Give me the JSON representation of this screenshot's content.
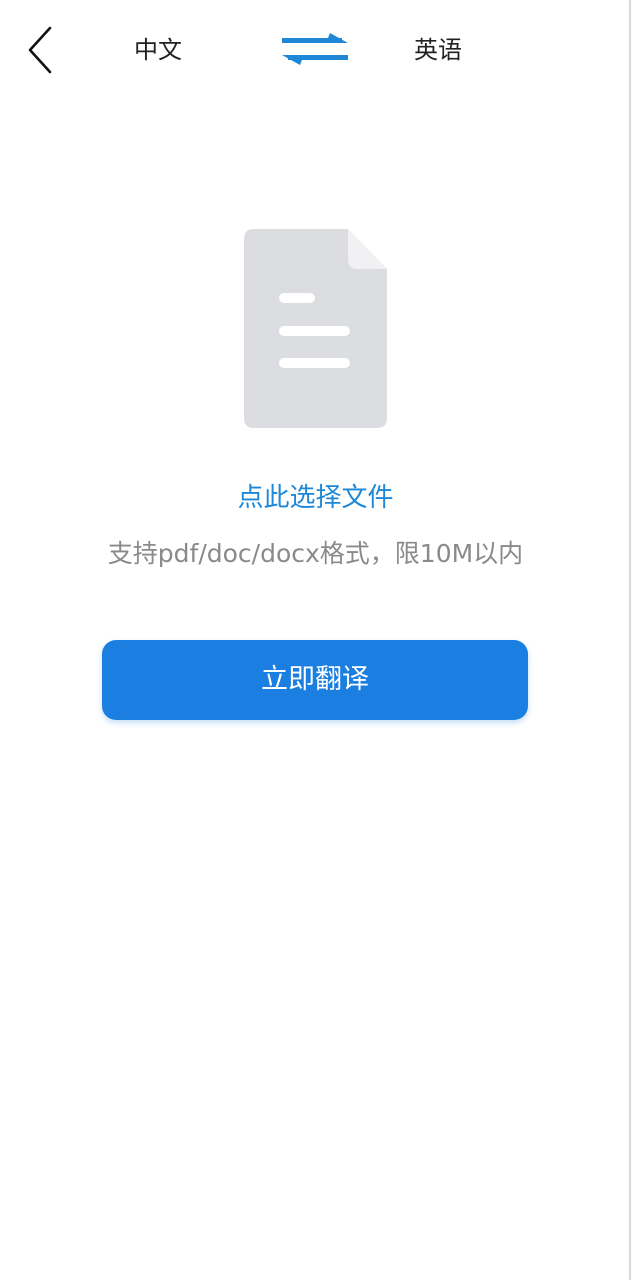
{
  "header": {
    "back_icon": "chevron-left-icon",
    "source_language": "中文",
    "swap_icon": "swap-arrows-icon",
    "target_language": "英语",
    "accent_color": "#1e88d6"
  },
  "upload": {
    "file_icon": "document-icon",
    "select_file_label": "点此选择文件",
    "hint": "支持pdf/doc/docx格式，限10M以内"
  },
  "actions": {
    "translate_label": "立即翻译",
    "button_color": "#1b7fe2"
  }
}
